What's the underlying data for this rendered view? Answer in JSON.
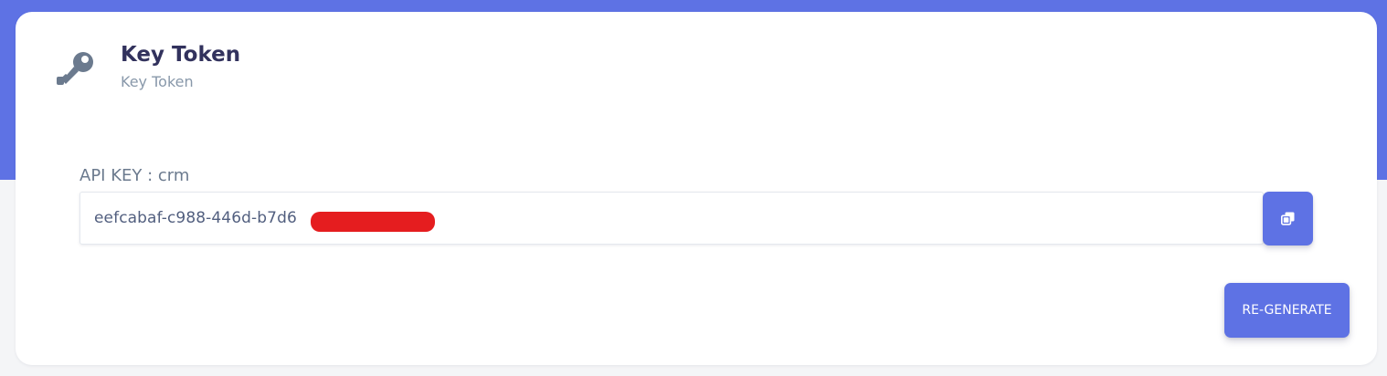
{
  "colors": {
    "accent": "#5e72e4",
    "card_background": "#ffffff",
    "page_background": "#f4f5f7",
    "redaction": "#e51d1f"
  },
  "header": {
    "icon": "key-icon",
    "title": "Key Token",
    "subtitle": "Key Token"
  },
  "api_key": {
    "label": "API KEY : crm",
    "value": "eefcabaf-c988-446d-b7d6",
    "copy_icon": "copy-icon"
  },
  "actions": {
    "regenerate_label": "RE-GENERATE"
  }
}
